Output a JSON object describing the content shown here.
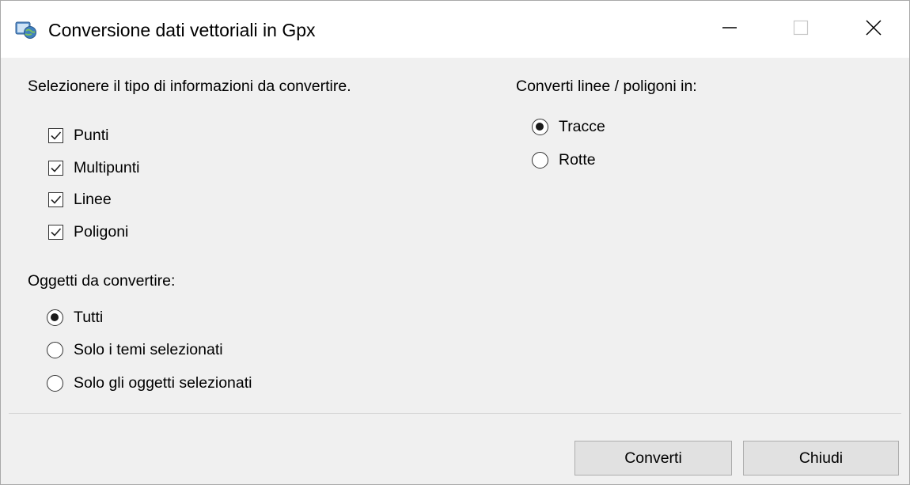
{
  "window": {
    "title": "Conversione dati vettoriali in Gpx",
    "app_icon": "gpx-app-icon",
    "controls": [
      "minimize-icon",
      "maximize-icon",
      "close-icon"
    ]
  },
  "types_section": {
    "heading": "Selezionere il tipo di informazioni da convertire.",
    "options": [
      {
        "label": "Punti",
        "checked": true
      },
      {
        "label": "Multipunti",
        "checked": true
      },
      {
        "label": "Linee",
        "checked": true
      },
      {
        "label": "Poligoni",
        "checked": true
      }
    ]
  },
  "objects_section": {
    "heading": "Oggetti da convertire:",
    "options": [
      {
        "label": "Tutti",
        "selected": true
      },
      {
        "label": "Solo i temi selezionati",
        "selected": false
      },
      {
        "label": "Solo gli oggetti selezionati",
        "selected": false
      }
    ]
  },
  "convert_section": {
    "heading": "Converti linee / poligoni in:",
    "options": [
      {
        "label": "Tracce",
        "selected": true
      },
      {
        "label": "Rotte",
        "selected": false
      }
    ]
  },
  "buttons": {
    "convert_label": "Converti",
    "close_label": "Chiudi"
  },
  "colors": {
    "titlebar_bg": "#ffffff",
    "dialog_bg": "#f0f0f0",
    "button_bg": "#e1e1e1",
    "button_border": "#adadad"
  }
}
